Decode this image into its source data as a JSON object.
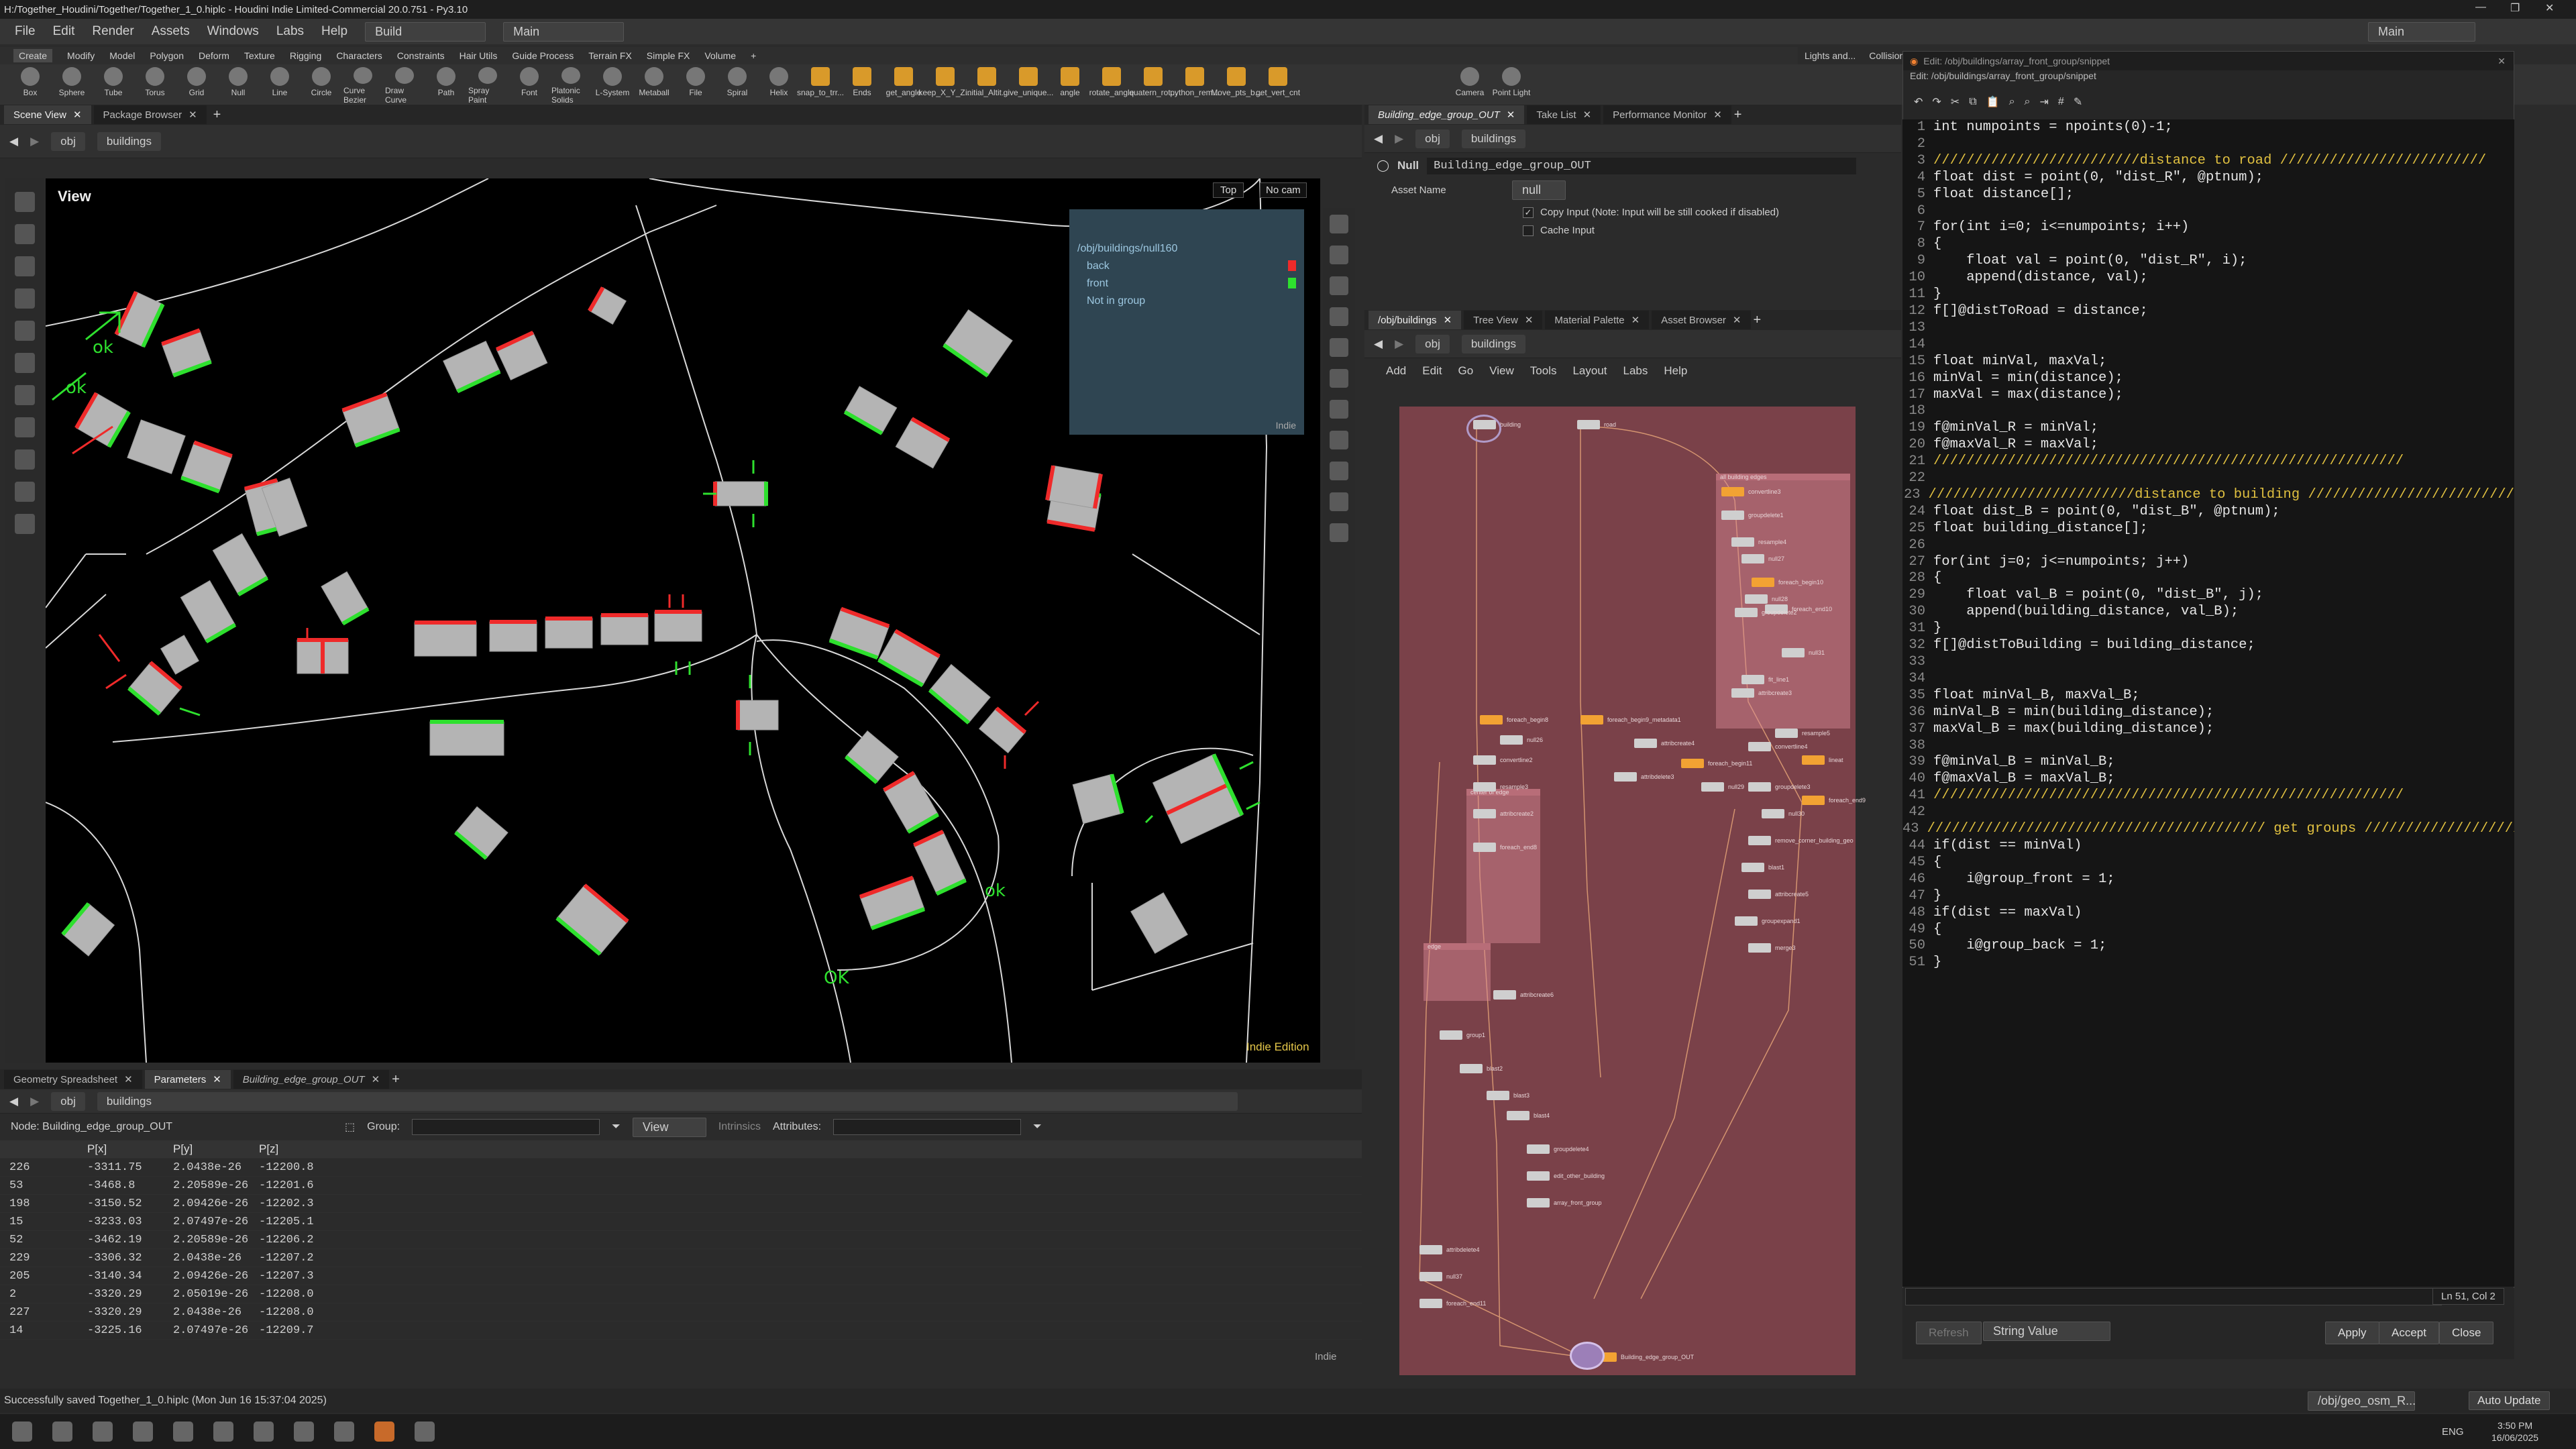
{
  "window": {
    "title": "H:/Together_Houdini/Together/Together_1_0.hiplc - Houdini Indie Limited-Commercial 20.0.751 - Py3.10"
  },
  "menu": {
    "items": [
      "File",
      "Edit",
      "Render",
      "Assets",
      "Windows",
      "Labs",
      "Help"
    ],
    "desktop": "Build",
    "context": "Main",
    "context2": "Main"
  },
  "shelf_tabs": [
    "Create",
    "Modify",
    "Model",
    "Polygon",
    "Deform",
    "Texture",
    "Rigging",
    "Characters",
    "Constraints",
    "Hair Utils",
    "Guide Process",
    "Terrain FX",
    "Simple FX",
    "Volume"
  ],
  "shelf_tools": [
    "Box",
    "Sphere",
    "Tube",
    "Torus",
    "Grid",
    "Null",
    "Line",
    "Circle",
    "Curve Bezier",
    "Draw Curve",
    "Path",
    "Spray Paint",
    "Font",
    "Platonic Solids",
    "L-System",
    "Metaball",
    "File",
    "Spiral",
    "Helix",
    "snap_to_trr...",
    "Ends",
    "get_angle",
    "keep_X_Y_Z...",
    "initial_Altit...",
    "give_unique...",
    "angle",
    "rotate_angle",
    "quatern_rot...",
    "python_rem...",
    "Move_pts_b...",
    "get_vert_cnt"
  ],
  "right_shelf": {
    "tabs": [
      "Lights and...",
      "Collision"
    ],
    "tools": [
      "Camera",
      "Point Light"
    ]
  },
  "scene_view": {
    "tabs": [
      "Scene View",
      "Package Browser"
    ],
    "path": {
      "root": "obj",
      "current": "buildings"
    },
    "view_label": "View",
    "view_top": "Top",
    "cam": "No cam",
    "edition": "Indie Edition",
    "group_box": {
      "title": "/obj/buildings/null160",
      "items": [
        "back",
        "front",
        "Not in group"
      ],
      "footer": "Indie"
    },
    "annotations": [
      "ok",
      "ok",
      "ok",
      "OK"
    ]
  },
  "geometry_sheet": {
    "tabs": [
      "Geometry Spreadsheet",
      "Parameters",
      "Building_edge_group_OUT"
    ],
    "path": {
      "root": "obj",
      "current": "buildings"
    },
    "node_label": "Node: Building_edge_group_OUT",
    "group_label": "Group:",
    "view_label": "View",
    "intrinsics": "Intrinsics",
    "attributes": "Attributes:",
    "columns": [
      "",
      "P[x]",
      "P[y]",
      "P[z]"
    ],
    "rows": [
      [
        "226",
        "-3311.75",
        "2.0438e-26",
        "-12200.8"
      ],
      [
        "53",
        "-3468.8",
        "2.20589e-26",
        "-12201.6"
      ],
      [
        "198",
        "-3150.52",
        "2.09426e-26",
        "-12202.3"
      ],
      [
        "15",
        "-3233.03",
        "2.07497e-26",
        "-12205.1"
      ],
      [
        "52",
        "-3462.19",
        "2.20589e-26",
        "-12206.2"
      ],
      [
        "229",
        "-3306.32",
        "2.0438e-26",
        "-12207.2"
      ],
      [
        "205",
        "-3140.34",
        "2.09426e-26",
        "-12207.3"
      ],
      [
        "2",
        "-3320.29",
        "2.05019e-26",
        "-12208.0"
      ],
      [
        "227",
        "-3320.29",
        "2.0438e-26",
        "-12208.0"
      ],
      [
        "14",
        "-3225.16",
        "2.07497e-26",
        "-12209.7"
      ]
    ],
    "footer": "Indie"
  },
  "params": {
    "tabs": [
      "Building_edge_group_OUT",
      "Take List",
      "Performance Monitor"
    ],
    "path": {
      "root": "obj",
      "current": "buildings"
    },
    "node_type": "Null",
    "node_name": "Building_edge_group_OUT",
    "asset_label": "Asset Name",
    "asset_value": "null",
    "copy_input": "Copy Input (Note: Input will be still cooked if disabled)",
    "cache_input": "Cache Input"
  },
  "network": {
    "tabs": [
      "/obj/buildings",
      "Tree View",
      "Material Palette",
      "Asset Browser"
    ],
    "path": {
      "root": "obj",
      "current": "buildings"
    },
    "menu": [
      "Add",
      "Edit",
      "Go",
      "View",
      "Tools",
      "Layout",
      "Labs",
      "Help"
    ],
    "boxes": [
      "all building edges",
      "center of edge",
      "edge"
    ],
    "nodes": [
      "building",
      "road",
      "foreach_begin8",
      "null26",
      "convertline2",
      "resample3",
      "attribcreate2",
      "foreach_end8",
      "foreach_begin9_metadata1",
      "convertline3",
      "groupdelete1",
      "resample4",
      "null27",
      "foreach_begin10",
      "null28",
      "foreach_end10",
      "groupdelete2",
      "null31",
      "fit_line1",
      "attribcreate3",
      "convertline4",
      "resample5",
      "attribcreate4",
      "foreach_begin11",
      "null29",
      "groupdelete3",
      "null30",
      "remove_corner_building_geo",
      "foreach_end9",
      "lineat",
      "attribdelete3",
      "blast1",
      "attribcreate5",
      "groupexpand1",
      "merge3",
      "attribcreate6",
      "group1",
      "blast2",
      "blast3",
      "blast4",
      "groupdelete4",
      "edit_other_building",
      "array_front_group",
      "attribdelete4",
      "null37",
      "foreach_end11",
      "Building_edge_group_OUT"
    ]
  },
  "editor": {
    "title": "Edit: /obj/buildings/array_front_group/snippet",
    "subtitle": "Edit: /obj/buildings/array_front_group/snippet",
    "lines": [
      "int numpoints = npoints(0)-1;",
      "",
      "/////////////////////////distance to road /////////////////////////",
      "float dist = point(0, \"dist_R\", @ptnum);",
      "float distance[];",
      "",
      "for(int i=0; i<=numpoints; i++)",
      "{",
      "    float val = point(0, \"dist_R\", i);",
      "    append(distance, val);",
      "}",
      "f[]@distToRoad = distance;",
      "",
      "",
      "float minVal, maxVal;",
      "minVal = min(distance);",
      "maxVal = max(distance);",
      "",
      "f@minVal_R = minVal;",
      "f@maxVal_R = maxVal;",
      "/////////////////////////////////////////////////////////",
      "",
      "/////////////////////////distance to building /////////////////////////",
      "float dist_B = point(0, \"dist_B\", @ptnum);",
      "float building_distance[];",
      "",
      "for(int j=0; j<=numpoints; j++)",
      "{",
      "    float val_B = point(0, \"dist_B\", j);",
      "    append(building_distance, val_B);",
      "}",
      "f[]@distToBuilding = building_distance;",
      "",
      "",
      "float minVal_B, maxVal_B;",
      "minVal_B = min(building_distance);",
      "maxVal_B = max(building_distance);",
      "",
      "f@minVal_B = minVal_B;",
      "f@maxVal_B = maxVal_B;",
      "/////////////////////////////////////////////////////////",
      "",
      "///////////////////////////////////////// get groups /////////////////////////",
      "if(dist == minVal)",
      "{",
      "    i@group_front = 1;",
      "}",
      "if(dist == maxVal)",
      "{",
      "    i@group_back = 1;",
      "}"
    ],
    "cursor": "Ln 51, Col 2",
    "refresh": "Refresh",
    "type": "String Value",
    "apply": "Apply",
    "accept": "Accept",
    "close": "Close"
  },
  "status": {
    "message": "Successfully saved Together_1_0.hiplc (Mon Jun 16 15:37:04 2025)",
    "path": "/obj/geo_osm_R...",
    "update": "Auto Update"
  },
  "taskbar": {
    "lang": "ENG",
    "time": "3:50 PM",
    "date": "16/06/2025"
  },
  "colors": {
    "front": "#2ee02e",
    "back": "#ef2a2a",
    "network_bg": "#7a4149",
    "group_box": "#2f4552"
  }
}
